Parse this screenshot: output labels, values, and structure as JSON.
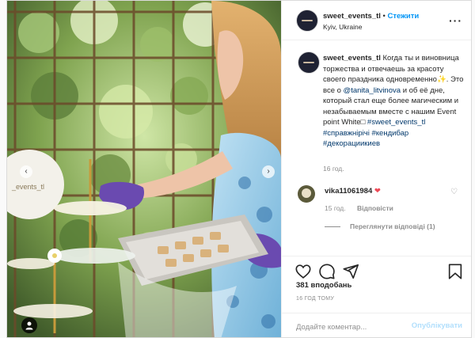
{
  "profile": {
    "username": "sweet_events_tl",
    "separator": "•",
    "follow_label": "Стежити",
    "location": "Kyiv, Ukraine"
  },
  "caption": {
    "username": "sweet_events_tl",
    "text_1": "Когда ты и виновница торжества и отвечаешь за красоту своего праздника одновременно",
    "sparkle": "✨",
    "text_2": ". Это все о",
    "mention": "@tanita_litvinova",
    "text_3": "и об её дне, который стал еще более магическим и незабываемым вместе с нашим Event point White□",
    "hashtags": "#sweet_events_tl #справжнірічі #кендибар #декорациикиев",
    "time": "16 год."
  },
  "comment": {
    "username": "vika11061984",
    "heart": "❤",
    "time": "15 год.",
    "reply_label": "Відповісти",
    "view_replies": "Переглянути відповіді (1)"
  },
  "post": {
    "likes": "381 вподобань",
    "date": "16 ГОД ТОМУ",
    "comment_placeholder": "Додайте коментар...",
    "publish_label": "Опублікувати"
  },
  "icons": {
    "more": "more-options-icon",
    "like": "heart-icon",
    "comment": "comment-bubble-icon",
    "share": "paper-plane-icon",
    "save": "bookmark-icon",
    "comment_like": "small-heart-icon",
    "carousel_prev": "chevron-left-icon",
    "carousel_next": "chevron-right-icon",
    "tagged_users": "user-tag-icon"
  },
  "colors": {
    "link_blue": "#0095f6",
    "mention_blue": "#00376b",
    "heart_red": "#ed4956",
    "muted": "#8e8e8e",
    "publish_disabled": "#b2dffc"
  }
}
